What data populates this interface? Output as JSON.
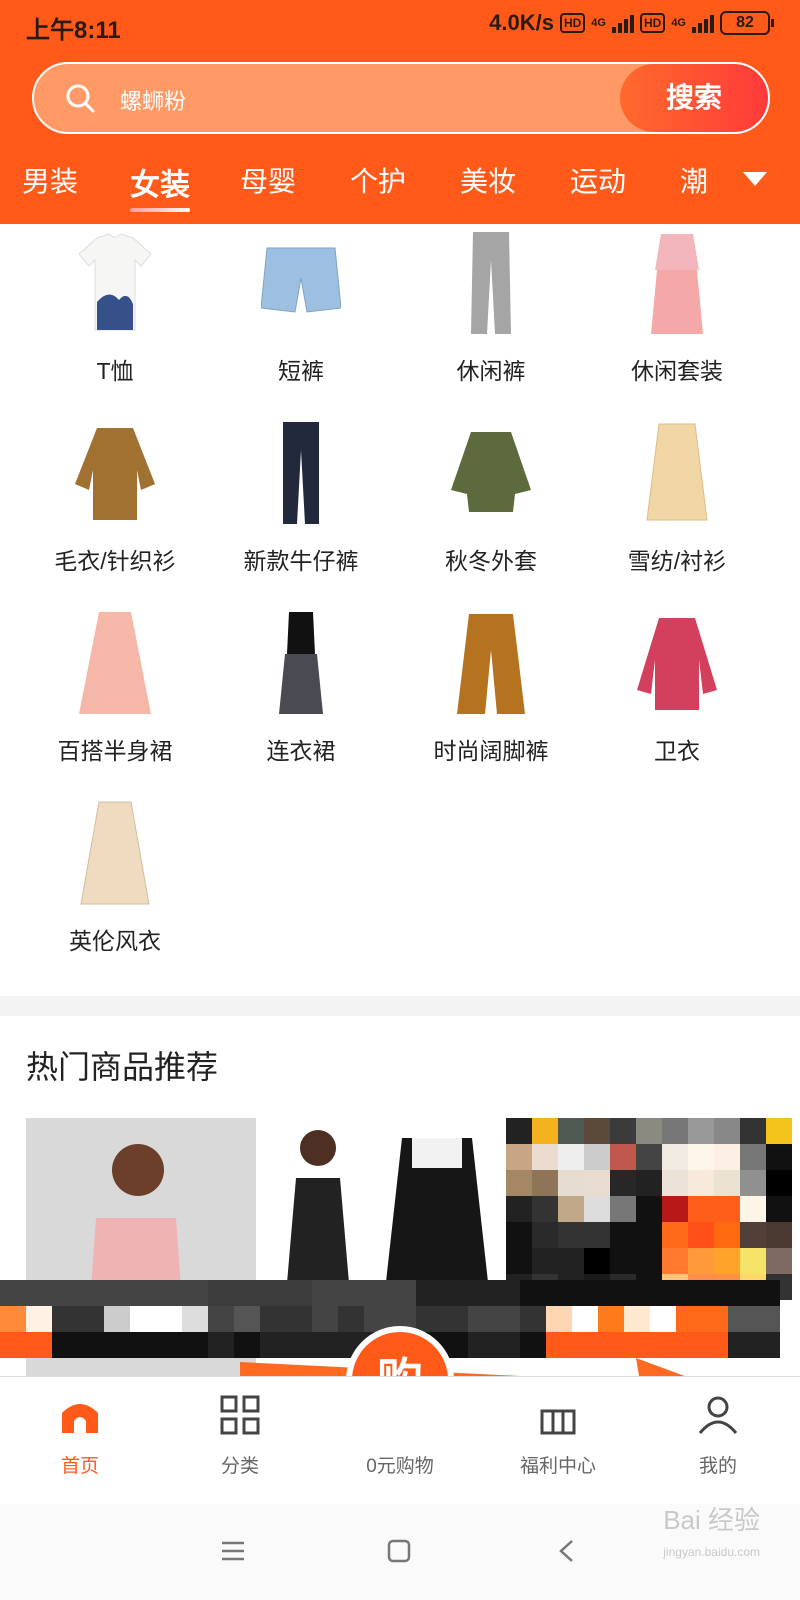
{
  "status_bar": {
    "time": "上午8:11",
    "speed": "4.0K/s",
    "hd1": "HD",
    "net1": "4G",
    "hd2": "HD",
    "net2": "4G",
    "battery": "82"
  },
  "search": {
    "placeholder": "螺蛳粉",
    "button_label": "搜索",
    "icon": "search-icon"
  },
  "tabs": [
    "男装",
    "女装",
    "母婴",
    "个护",
    "美妆",
    "运动",
    "潮"
  ],
  "active_tab": "女装",
  "categories": [
    {
      "label": "T恤",
      "icon": "tshirt-image"
    },
    {
      "label": "短裤",
      "icon": "shorts-image"
    },
    {
      "label": "休闲裤",
      "icon": "pants-image"
    },
    {
      "label": "休闲套装",
      "icon": "outfit-set-image"
    },
    {
      "label": "毛衣/针织衫",
      "icon": "sweater-image"
    },
    {
      "label": "新款牛仔裤",
      "icon": "jeans-image"
    },
    {
      "label": "秋冬外套",
      "icon": "jacket-image"
    },
    {
      "label": "雪纺/衬衫",
      "icon": "shirt-image"
    },
    {
      "label": "百搭半身裙",
      "icon": "skirt-image"
    },
    {
      "label": "连衣裙",
      "icon": "dress-image"
    },
    {
      "label": "时尚阔脚裤",
      "icon": "wide-leg-pants-image"
    },
    {
      "label": "卫衣",
      "icon": "hoodie-image"
    },
    {
      "label": "英伦风衣",
      "icon": "trench-coat-image"
    }
  ],
  "hot": {
    "title": "热门商品推荐"
  },
  "bottom_nav": [
    {
      "label": "首页",
      "icon": "home-icon",
      "active": true
    },
    {
      "label": "分类",
      "icon": "grid-icon",
      "active": false
    },
    {
      "label": "0元购物",
      "icon": "buy-icon",
      "active": false
    },
    {
      "label": "福利中心",
      "icon": "gift-icon",
      "active": false
    },
    {
      "label": "我的",
      "icon": "user-icon",
      "active": false
    }
  ],
  "zero_buy_glyph": "购",
  "watermark": {
    "main": "Bai 经验",
    "sub": "jingyan.baidu.com"
  },
  "colors": {
    "brand": "#ff5a1a",
    "annotation_arrow": "#ff6a20"
  }
}
